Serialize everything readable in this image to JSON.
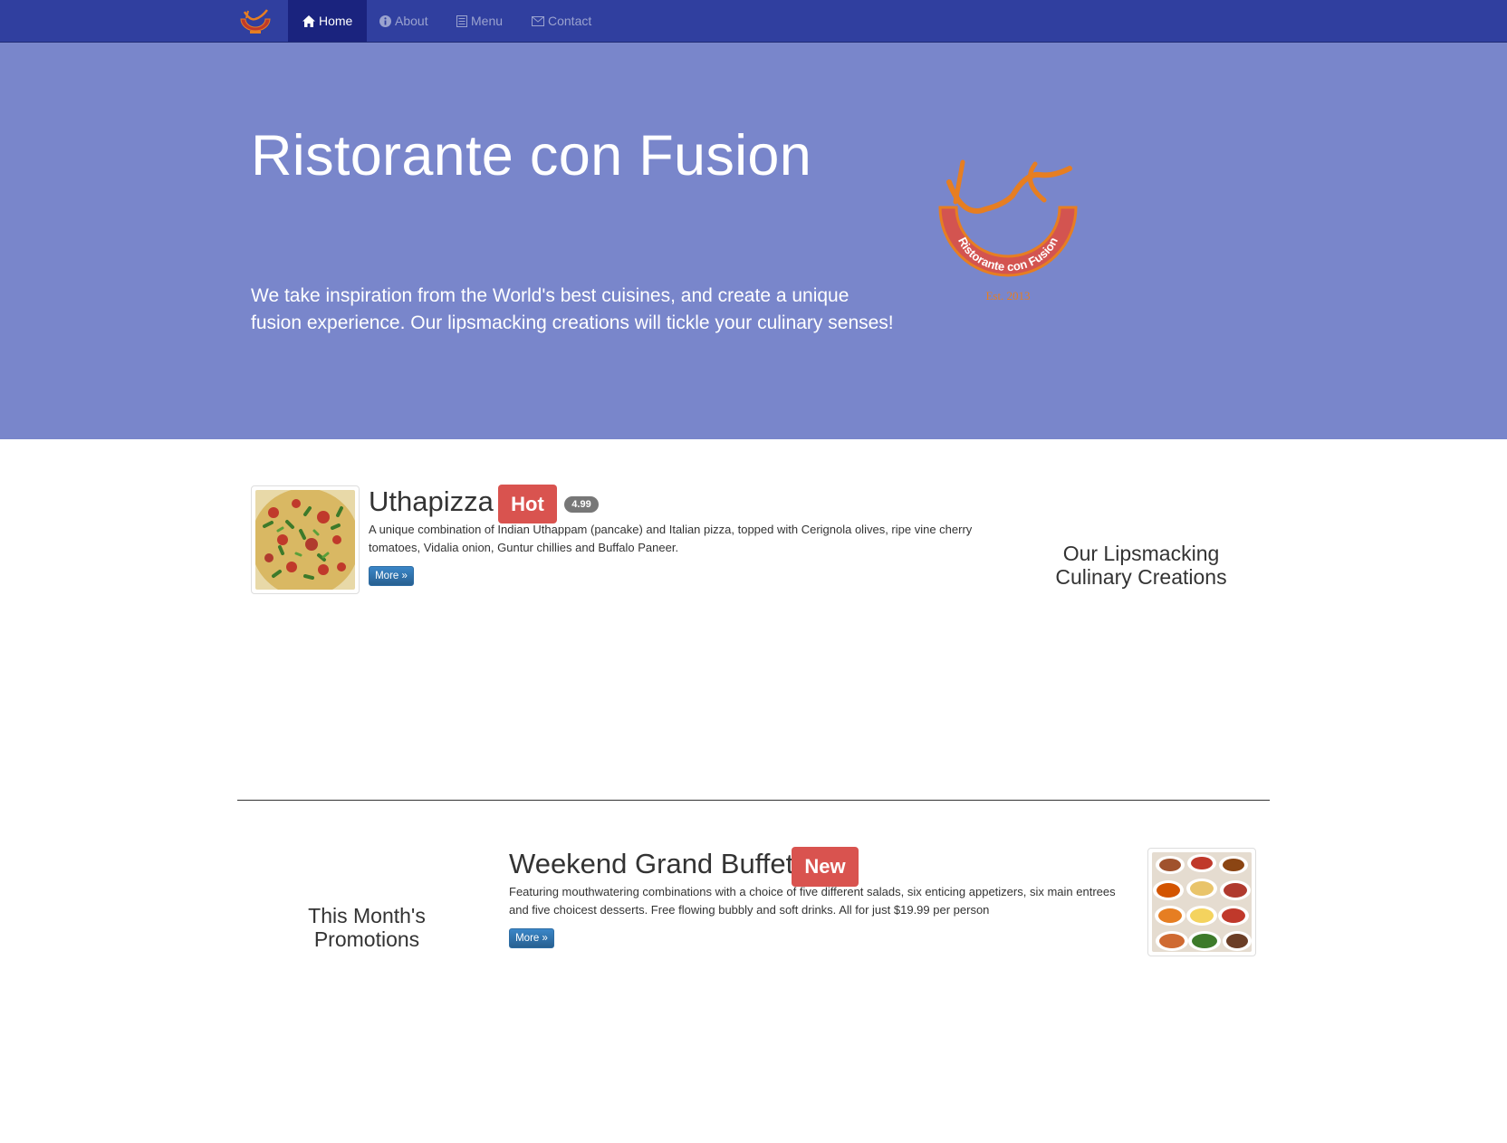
{
  "navbar": {
    "brand_logo": "ristorante-con-fusion-logo",
    "items": [
      {
        "label": "Home",
        "icon": "home-icon",
        "active": true
      },
      {
        "label": "About",
        "icon": "info-circle-icon",
        "active": false
      },
      {
        "label": "Menu",
        "icon": "list-icon",
        "active": false
      },
      {
        "label": "Contact",
        "icon": "envelope-icon",
        "active": false
      }
    ]
  },
  "jumbotron": {
    "title": "Ristorante con Fusion",
    "text": "We take inspiration from the World's best cuisines, and create a unique fusion experience. Our lipsmacking creations will tickle your culinary senses!",
    "logo": {
      "text": "Ristorante con Fusion",
      "est": "Est. 2013"
    }
  },
  "featured_dish": {
    "name": "Uthapizza",
    "label": "Hot",
    "price": "4.99",
    "description": "A unique combination of Indian Uthappam (pancake) and Italian pizza, topped with Cerignola olives, ripe vine cherry tomatoes, Vidalia onion, Guntur chillies and Buffalo Paneer.",
    "button": "More »",
    "side_heading": "Our Lipsmacking Culinary Creations"
  },
  "promotion": {
    "side_heading": "This Month's Promotions",
    "name": "Weekend Grand Buffet",
    "label": "New",
    "description": "Featuring mouthwatering combinations with a choice of five different salads, six enticing appetizers, six main entrees and five choicest desserts. Free flowing bubbly and soft drinks. All for just $19.99 per person",
    "button": "More »"
  },
  "colors": {
    "navbar": "#303f9f",
    "navbar_active": "#1a237e",
    "jumbotron": "#7986cb",
    "label_danger": "#d9534f",
    "badge": "#777777",
    "button_primary": "#337ab7"
  }
}
